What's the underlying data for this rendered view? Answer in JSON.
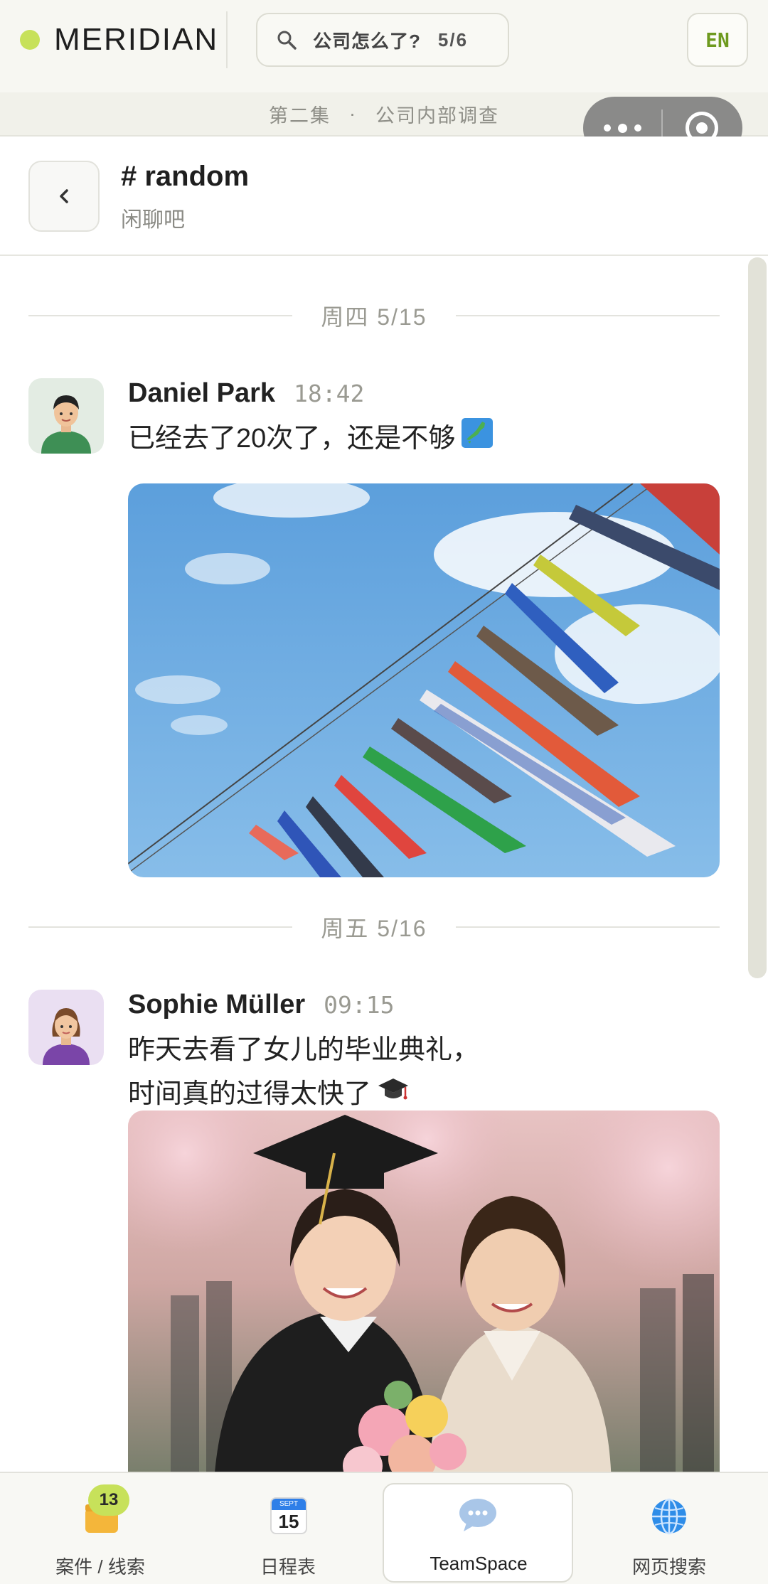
{
  "brand": {
    "name": "MERIDIAN",
    "status_color": "#c7e15a"
  },
  "search": {
    "text": "公司怎么了?",
    "count": "5/6"
  },
  "language_button": "EN",
  "episode": {
    "number": "第二集",
    "separator": "·",
    "title": "公司内部调查"
  },
  "channel": {
    "name": "# random",
    "description": "闲聊吧"
  },
  "messages": [
    {
      "day": "周四  5/15",
      "author": "Daniel Park",
      "time": "18:42",
      "text": "已经去了20次了，还是不够",
      "emoji": "japan-map-icon",
      "attachment": "koinobori-carp-streamers-photo"
    },
    {
      "day": "周五  5/16",
      "author": "Sophie Müller",
      "time": "09:15",
      "text": "昨天去看了女儿的毕业典礼，\n时间真的过得太快了",
      "emoji": "graduation-cap-icon",
      "attachment": "graduation-ceremony-photo"
    }
  ],
  "nav": {
    "items": [
      {
        "label": "案件 / 线索",
        "icon": "folder-icon",
        "badge": "13"
      },
      {
        "label": "日程表",
        "icon": "calendar-icon",
        "calendar_month": "SEPT",
        "calendar_day": "15"
      },
      {
        "label": "TeamSpace",
        "icon": "chat-bubble-icon",
        "active": true
      },
      {
        "label": "网页搜索",
        "icon": "globe-icon"
      }
    ]
  }
}
